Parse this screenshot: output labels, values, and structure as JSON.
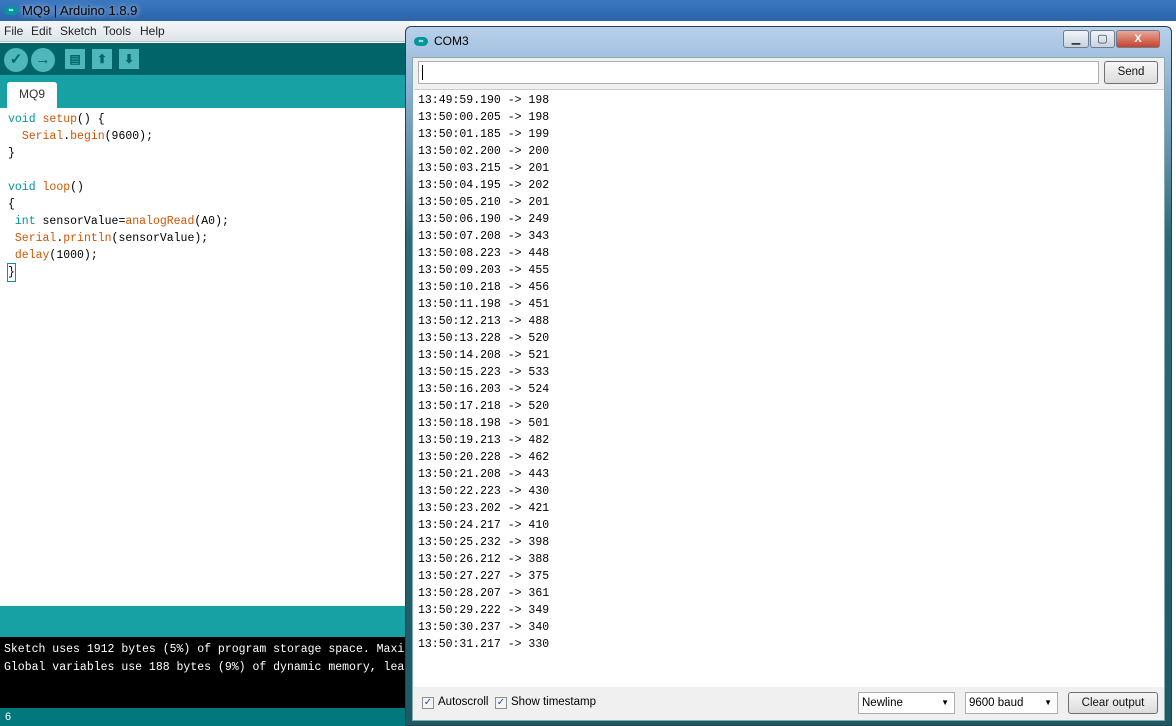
{
  "ide": {
    "window_title": "MQ9 | Arduino 1.8.9",
    "menu": [
      "File",
      "Edit",
      "Sketch",
      "Tools",
      "Help"
    ],
    "toolbar": {
      "verify": "checkmark-icon",
      "upload": "arrow-right-icon",
      "new": "new-file-icon",
      "open": "arrow-up-icon",
      "save": "arrow-down-icon"
    },
    "tab": "MQ9",
    "code_lines": [
      "void setup() {",
      "  Serial.begin(9600);",
      "}",
      "",
      "void loop()",
      "{",
      " int sensorValue=analogRead(A0);",
      " Serial.println(sensorValue);",
      " delay(1000);",
      "}"
    ],
    "console": [
      "Sketch uses 1912 bytes (5%) of program storage space. Maxi",
      "Global variables use 188 bytes (9%) of dynamic memory, lea"
    ],
    "status_line": "6",
    "colors": {
      "toolbar": "#006468",
      "tabbar": "#17a1a5",
      "keyword": "#00979c",
      "function": "#d35400"
    }
  },
  "monitor": {
    "title": "COM3",
    "input_value": "",
    "send_label": "Send",
    "output": [
      "13:49:59.190 -> 198",
      "13:50:00.205 -> 198",
      "13:50:01.185 -> 199",
      "13:50:02.200 -> 200",
      "13:50:03.215 -> 201",
      "13:50:04.195 -> 202",
      "13:50:05.210 -> 201",
      "13:50:06.190 -> 249",
      "13:50:07.208 -> 343",
      "13:50:08.223 -> 448",
      "13:50:09.203 -> 455",
      "13:50:10.218 -> 456",
      "13:50:11.198 -> 451",
      "13:50:12.213 -> 488",
      "13:50:13.228 -> 520",
      "13:50:14.208 -> 521",
      "13:50:15.223 -> 533",
      "13:50:16.203 -> 524",
      "13:50:17.218 -> 520",
      "13:50:18.198 -> 501",
      "13:50:19.213 -> 482",
      "13:50:20.228 -> 462",
      "13:50:21.208 -> 443",
      "13:50:22.223 -> 430",
      "13:50:23.202 -> 421",
      "13:50:24.217 -> 410",
      "13:50:25.232 -> 398",
      "13:50:26.212 -> 388",
      "13:50:27.227 -> 375",
      "13:50:28.207 -> 361",
      "13:50:29.222 -> 349",
      "13:50:30.237 -> 340",
      "13:50:31.217 -> 330"
    ],
    "autoscroll": {
      "label": "Autoscroll",
      "checked": true
    },
    "show_timestamp": {
      "label": "Show timestamp",
      "checked": true
    },
    "line_ending": "Newline",
    "baud": "9600 baud",
    "clear_label": "Clear output"
  }
}
